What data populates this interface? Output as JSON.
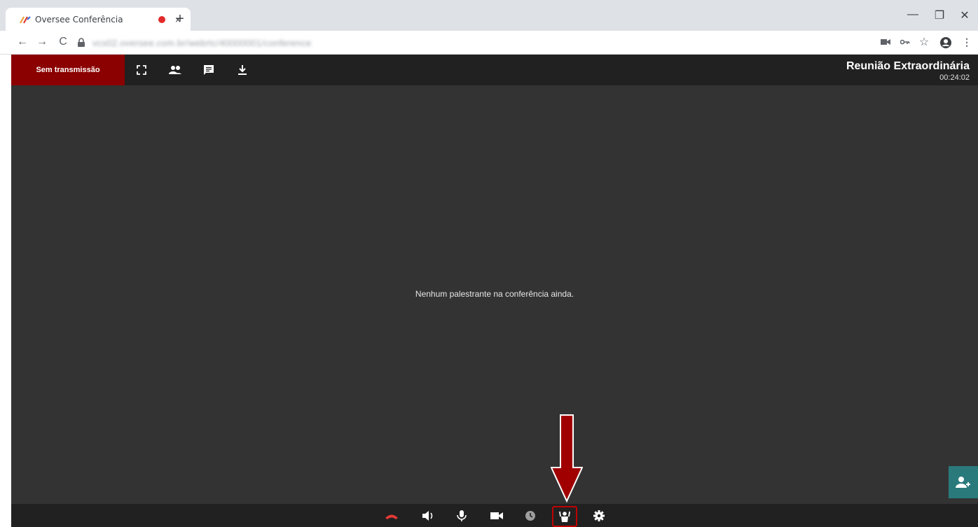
{
  "browser": {
    "tab_title": "Oversee Conferência",
    "tab_close": "×",
    "new_tab": "+",
    "url": "vcs02.oversee.com.br/webrtc/40000001/conference",
    "window_controls": {
      "minimize": "—",
      "restore": "❐",
      "close": "✕"
    },
    "nav": {
      "back": "←",
      "forward": "→",
      "reload": "C"
    },
    "address_icons": [
      "camera-icon",
      "key-icon",
      "star-icon",
      "profile-icon",
      "menu-icon"
    ]
  },
  "topbar": {
    "status_label": "Sem transmissão",
    "icons": [
      "fullscreen-icon",
      "participants-icon",
      "chat-icon",
      "download-icon"
    ],
    "meeting_title": "Reunião Extraordinária",
    "elapsed_time": "00:24:02"
  },
  "stage": {
    "message": "Nenhum palestrante na conferência ainda."
  },
  "controls": {
    "items": [
      "hangup-icon",
      "speaker-icon",
      "microphone-icon",
      "camera-icon",
      "clock-icon",
      "raise-hand-icon",
      "settings-icon"
    ],
    "highlighted": "raise-hand-icon"
  },
  "colors": {
    "status_bg": "#8b0000",
    "app_bg": "#333333",
    "bar_bg": "#212121",
    "invite_bg": "#2a7a7c",
    "hangup": "#e53935",
    "annotation": "#a00000"
  }
}
